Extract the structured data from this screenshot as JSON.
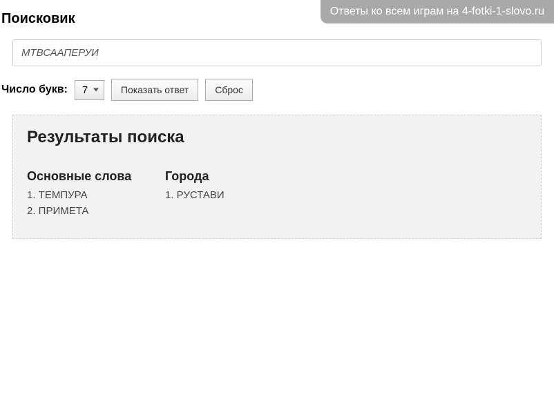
{
  "banner": {
    "text": "Ответы ко всем играм на 4-fotki-1-slovo.ru"
  },
  "page": {
    "title": "Поисковик"
  },
  "search": {
    "value": "МТВСААПЕРУИ"
  },
  "controls": {
    "letter_count_label": "Число букв:",
    "selected_count": "7",
    "show_answer_label": "Показать ответ",
    "reset_label": "Сброс"
  },
  "results": {
    "title": "Результаты поиска",
    "columns": [
      {
        "heading": "Основные слова",
        "items": [
          "1. ТЕМПУРА",
          "2. ПРИМЕТА"
        ]
      },
      {
        "heading": "Города",
        "items": [
          "1. РУСТАВИ"
        ]
      }
    ]
  }
}
